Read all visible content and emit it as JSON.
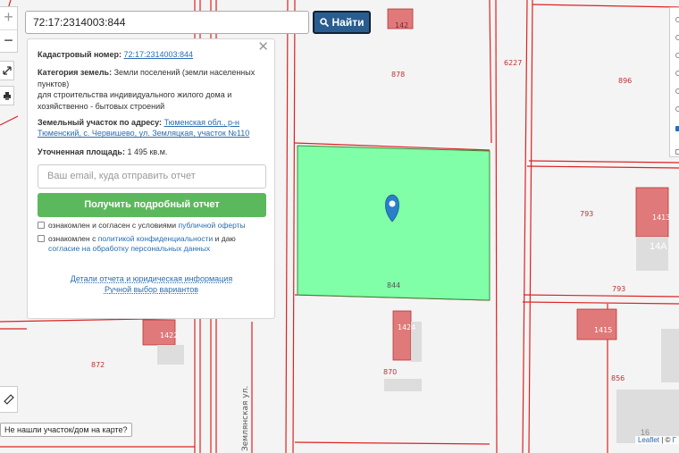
{
  "search": {
    "value": "72:17:2314003:844",
    "button_label": "Найти"
  },
  "zoom": {
    "in_label": "+",
    "out_label": "−"
  },
  "panel": {
    "cadastral_label": "Кадастровый номер:",
    "cadastral_value": "72:17:2314003:844",
    "category_label": "Категория земель:",
    "category_value": "Земли поселений (земли населенных пунктов)",
    "category_use": "для строительства индивидуального жилого дома и хозяйственно - бытовых строений",
    "address_label": "Земельный участок по адресу:",
    "address_value": "Тюменская обл., р-н Тюменский, с. Червишево, ул. Земляцкая, участок №110",
    "area_label": "Уточненная площадь:",
    "area_value": "1 495 кв.м.",
    "email_placeholder": "Ваш email, куда отправить отчет",
    "report_button": "Получить подробный отчет",
    "check1_text": "ознакомлен и согласен с условиями",
    "check1_link": "публичной оферты",
    "check2_text": "ознакомлен с",
    "check2_link1": "политикой конфиденциальности",
    "check2_mid": "и даю",
    "check2_link2": "согласие на обработку персональных данных",
    "details_link": "Детали отчета и юридическая информация",
    "manual_link": "Ручной выбор вариантов"
  },
  "map": {
    "parcels": [
      "878",
      "6227",
      "896",
      "793",
      "793",
      "844",
      "870",
      "872",
      "856",
      "142",
      "1413",
      "1415",
      "1422",
      "1424"
    ],
    "house_numbers": [
      "14А",
      "16"
    ],
    "street": "Землянская ул.",
    "selected_color": "#80ffa8",
    "building_color": "#e07a7a"
  },
  "not_found": "Не нашли участок/дом на карте?",
  "attribution": {
    "leaflet": "Leaflet",
    "sep": " | © ",
    "rest": "Г"
  }
}
